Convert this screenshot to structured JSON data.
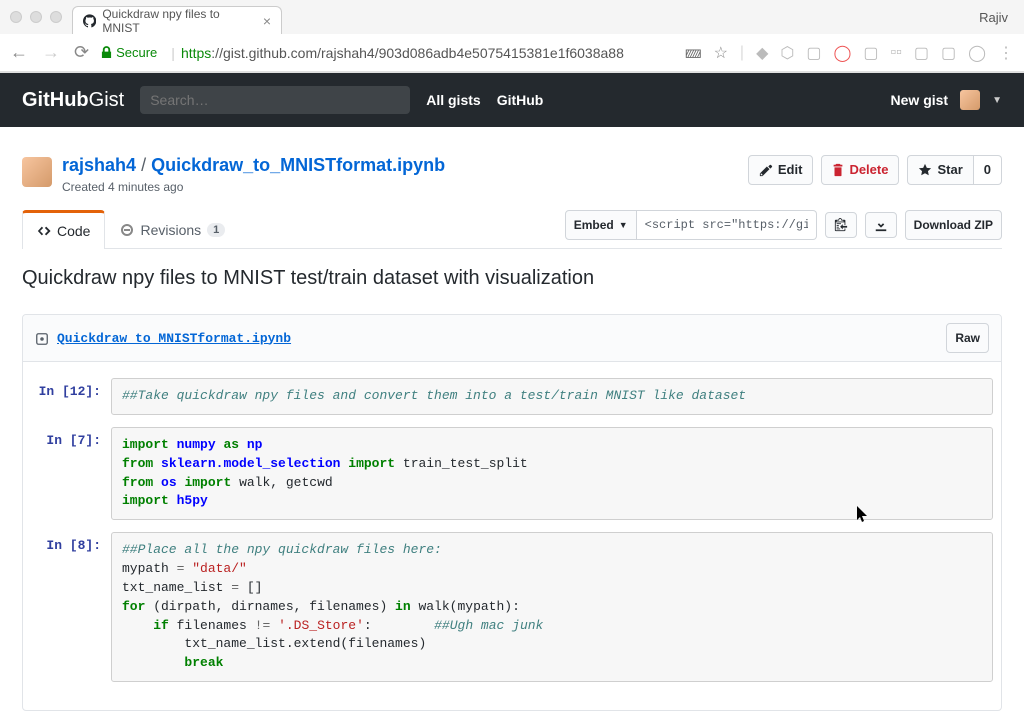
{
  "browser": {
    "tab_title": "Quickdraw npy files to MNIST",
    "profile": "Rajiv",
    "secure_label": "Secure",
    "url_proto": "https",
    "url_rest": "://gist.github.com/rajshah4/903d086adb4e5075415381e1f6038a88"
  },
  "header": {
    "logo_bold": "GitHub",
    "logo_thin": "Gist",
    "search_placeholder": "Search…",
    "nav1": "All gists",
    "nav2": "GitHub",
    "new_gist": "New gist"
  },
  "gist": {
    "owner": "rajshah4",
    "filename": "Quickdraw_to_MNISTformat.ipynb",
    "created": "Created 4 minutes ago",
    "edit": "Edit",
    "delete": "Delete",
    "star": "Star",
    "star_count": "0"
  },
  "tabs": {
    "code": "Code",
    "revisions": "Revisions",
    "rev_count": "1",
    "embed": "Embed",
    "embed_value": "<script src=\"https://gis",
    "download": "Download ZIP"
  },
  "description": "Quickdraw npy files to MNIST test/train dataset with visualization",
  "file": {
    "name": "Quickdraw_to_MNISTformat.ipynb",
    "raw": "Raw"
  },
  "cells": {
    "p1": "In [12]:",
    "c1": "##Take quickdraw npy files and convert them into a test/train MNIST like dataset",
    "p2": "In [7]:",
    "c2_l1_a": "import",
    "c2_l1_b": "numpy",
    "c2_l1_c": "as",
    "c2_l1_d": "np",
    "c2_l2_a": "from",
    "c2_l2_b": "sklearn.model_selection",
    "c2_l2_c": "import",
    "c2_l2_d": "train_test_split",
    "c2_l3_a": "from",
    "c2_l3_b": "os",
    "c2_l3_c": "import",
    "c2_l3_d": "walk, getcwd",
    "c2_l4_a": "import",
    "c2_l4_b": "h5py",
    "p3": "In [8]:",
    "c3_l1": "##Place all the npy quickdraw files here:",
    "c3_l2_a": "mypath ",
    "c3_l2_b": "=",
    "c3_l2_c": " \"data/\"",
    "c3_l3_a": "txt_name_list ",
    "c3_l3_b": "=",
    "c3_l3_c": " []",
    "c3_l4_a": "for",
    "c3_l4_b": " (dirpath, dirnames, filenames) ",
    "c3_l4_c": "in",
    "c3_l4_d": " walk(mypath):",
    "c3_l5_a": "    ",
    "c3_l5_b": "if",
    "c3_l5_c": " filenames ",
    "c3_l5_d": "!=",
    "c3_l5_e": " ",
    "c3_l5_f": "'.DS_Store'",
    "c3_l5_g": ":        ",
    "c3_l5_h": "##Ugh mac junk",
    "c3_l6": "        txt_name_list.extend(filenames)",
    "c3_l7_a": "        ",
    "c3_l7_b": "break"
  }
}
